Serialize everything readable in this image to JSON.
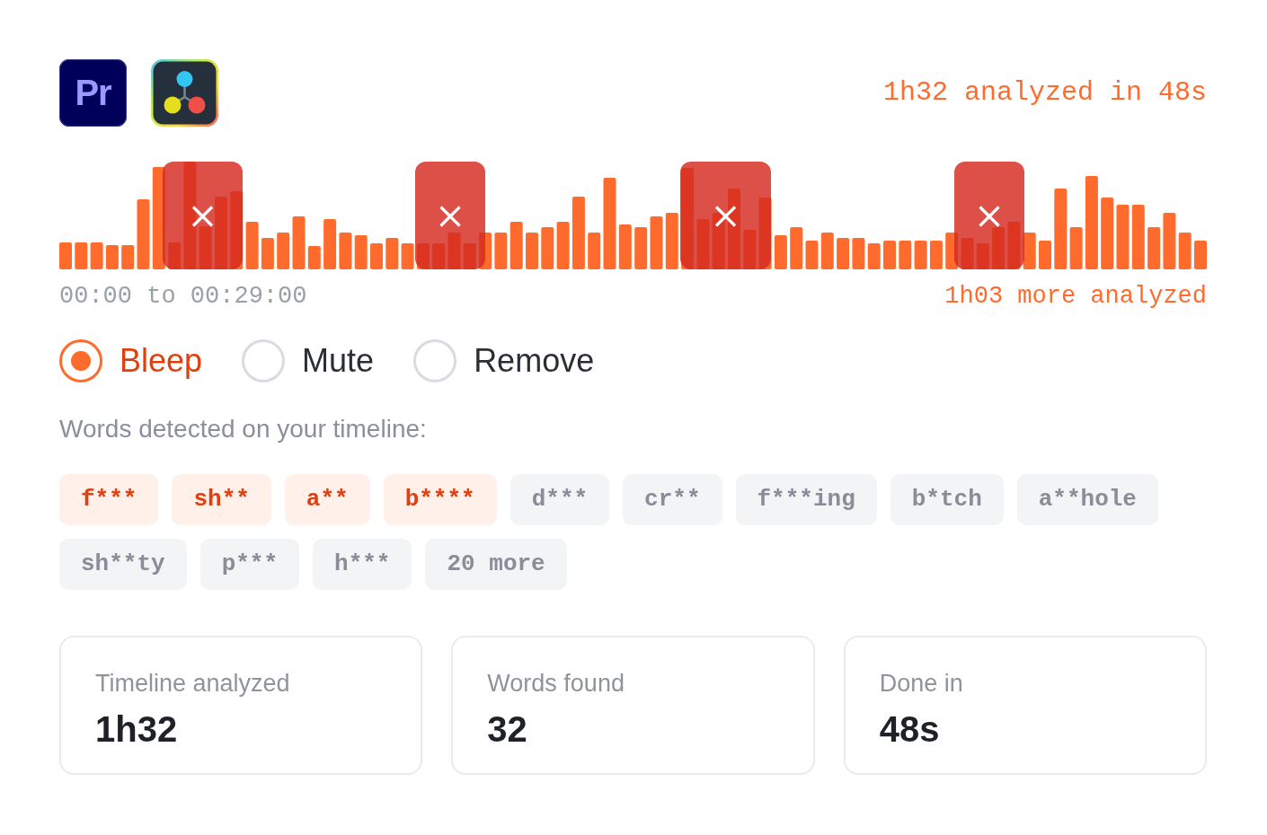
{
  "apps": [
    {
      "kind": "premiere",
      "label": "Pr"
    },
    {
      "kind": "resolve"
    }
  ],
  "summary": "1h32 analyzed in 48s",
  "timeline": {
    "range": "00:00 to 00:29:00",
    "more": "1h03 more analyzed"
  },
  "actions": [
    {
      "label": "Bleep",
      "selected": true
    },
    {
      "label": "Mute",
      "selected": false
    },
    {
      "label": "Remove",
      "selected": false
    }
  ],
  "words_heading": "Words detected on your timeline:",
  "words": [
    {
      "label": "f***",
      "active": true
    },
    {
      "label": "sh**",
      "active": true
    },
    {
      "label": "a**",
      "active": true
    },
    {
      "label": "b****",
      "active": true
    },
    {
      "label": "d***",
      "active": false
    },
    {
      "label": "cr**",
      "active": false
    },
    {
      "label": "f***ing",
      "active": false
    },
    {
      "label": "b*tch",
      "active": false
    },
    {
      "label": "a**hole",
      "active": false
    },
    {
      "label": "sh**ty",
      "active": false
    },
    {
      "label": "p***",
      "active": false
    },
    {
      "label": "h***",
      "active": false
    },
    {
      "label": "20 more",
      "active": false
    }
  ],
  "stats": [
    {
      "label": "Timeline analyzed",
      "value": "1h32"
    },
    {
      "label": "Words found",
      "value": "32"
    },
    {
      "label": "Done in",
      "value": "48s"
    }
  ]
}
